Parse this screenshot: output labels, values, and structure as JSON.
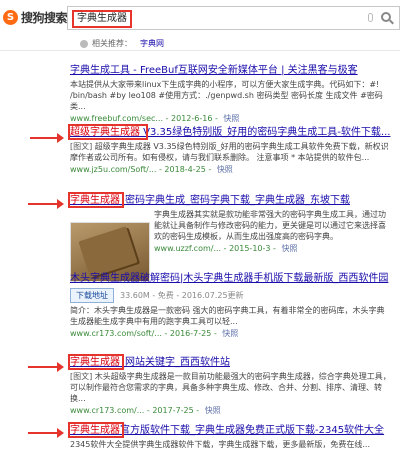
{
  "header": {
    "logo_mark": "S",
    "logo_text": "搜狗搜索",
    "query": "字典生成器"
  },
  "related": {
    "label": "相关推荐：",
    "link": "字典网"
  },
  "results": [
    {
      "title_pre": "字典生成工具 - FreeBuf互联网安全新媒体平台 | 关注黑客与极客",
      "snippet": "本站提供从大家带来linux下生成字典的小程序，可以方便大家生成字典。代码如下：#! /bin/bash #by leo108 #使用方式：./genpwd.sh 密码类型 密码长度 生成文件 #密码类...",
      "url": "www.freebuf.com/sec... - 2012-6-16 - ",
      "snap": "快照"
    },
    {
      "title_hl": "超级字典生成器",
      "title_rest": " V3.35绿色特别版_好用的密码字典生成工具-软件下载...",
      "tag": "[图文]",
      "snippet": "超级字典生成器 V3.35绿色特别版_好用的密码字典生成工具软件免费下载，新权识摩作者或公司所有。如有侵权，请与我们联系删除。 注意事项 * 本站提供的软件包...",
      "url": "www.jz5u.com/Soft/... - 2018-4-25 - ",
      "snap": "快照"
    },
    {
      "title_hl": "字典生成器",
      "title_rest": "_密码字典生成_密码字典下载_字典生成器_东坡下载",
      "snippet": "字典生成器其实就是款功能非常强大的密码字典生成工具，通过功能就让具备制作与修改密码的能力，更关键是可以通过它来选择喜欢的密码生成模板，从而生成出强度高的密码字典。",
      "url": "www.uzzf.com/... - 2015-10-3 - ",
      "snap": "快照"
    },
    {
      "title_pre": "木头字典生成器破解密码|木头字典生成器手机版下载最新版_西西软件园",
      "download_label": "下载地址",
      "meta": "33.60M - 免费 - 2016.07.25更新",
      "snippet": "简介：木头字典生成器是一款密码 强大的密码字典工具，有着非常全的密码库，木头字典生成器能生成字典中有用的跑字典工具可以轻...",
      "url": "www.cr173.com/soft/... - 2016-7-25 - ",
      "snap": "快照"
    },
    {
      "title_hl": "字典生成器",
      "title_rest": "_网站关键字_西西软件站",
      "tag": "[图文]",
      "snippet": "木头超级字典生成器是一款目前功能最强大的密码字典生成器，综合字典处理工具，可以制作最符合您需求的字典，具备多种字典生成、修改、合并、分割、排序、清理、转换...",
      "url": "www.cr173.com/... - 2017-7-25 - ",
      "snap": "快照"
    },
    {
      "title_hl": "字典生成器",
      "title_rest": "官方版软件下载_字典生成器免费正式版下载-2345软件大全",
      "snippet": "2345软件大全提供字典生成器软件下载，字典生成器下载，更多最新版，免费在线..."
    }
  ]
}
